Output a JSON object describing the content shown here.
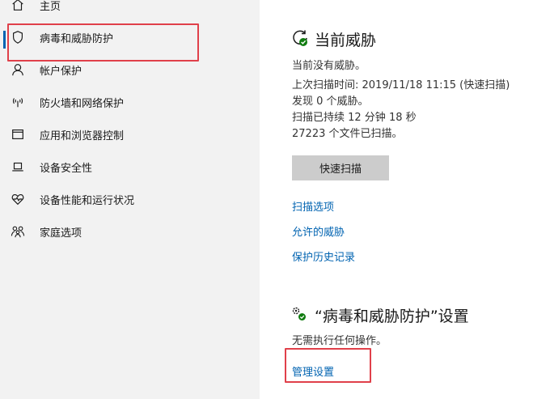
{
  "sidebar": {
    "items": [
      {
        "label": "主页",
        "icon": "home-icon"
      },
      {
        "label": "病毒和威胁防护",
        "icon": "shield-icon"
      },
      {
        "label": "帐户保护",
        "icon": "person-icon"
      },
      {
        "label": "防火墙和网络保护",
        "icon": "wifi-antenna-icon"
      },
      {
        "label": "应用和浏览器控制",
        "icon": "app-window-icon"
      },
      {
        "label": "设备安全性",
        "icon": "laptop-icon"
      },
      {
        "label": "设备性能和运行状况",
        "icon": "heart-pulse-icon"
      },
      {
        "label": "家庭选项",
        "icon": "family-icon"
      }
    ]
  },
  "threats": {
    "title": "当前威胁",
    "status": "当前没有威胁。",
    "last_scan": "上次扫描时间: 2019/11/18 11:15 (快速扫描)",
    "found": "发现 0 个威胁。",
    "duration": "扫描已持续 12 分钟 18 秒",
    "files_scanned": "27223 个文件已扫描。",
    "quick_scan_button": "快速扫描",
    "links": {
      "scan_options": "扫描选项",
      "allowed_threats": "允许的威胁",
      "protection_history": "保护历史记录"
    }
  },
  "settings": {
    "title": "“病毒和威胁防护”设置",
    "status": "无需执行任何操作。",
    "manage_link": "管理设置"
  },
  "colors": {
    "accent": "#0063b1",
    "highlight": "#e0404a",
    "sidebar_bg": "#f2f2f2",
    "status_ok": "#107c10"
  }
}
